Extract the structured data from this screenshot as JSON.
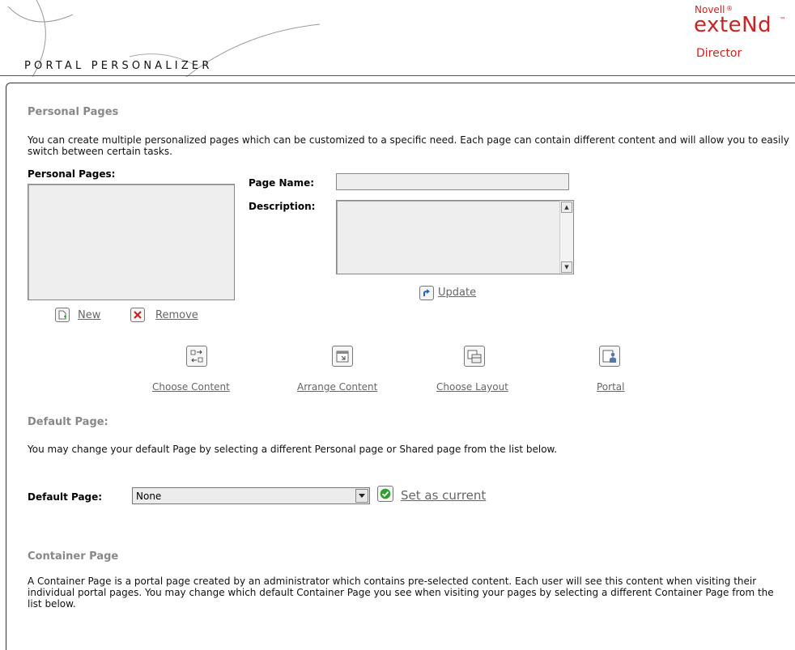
{
  "header": {
    "app_title": "PORTAL PERSONALIZER",
    "logo": {
      "novell": "Novell",
      "extend": "exteNd",
      "tm": "™",
      "director": "Director"
    }
  },
  "personal_pages": {
    "heading": "Personal Pages",
    "intro": "You can create multiple personalized pages which can be customized to a specific need. Each page can contain different content and will allow you to easily switch between certain tasks.",
    "list_label": "Personal Pages:",
    "page_name_label": "Page Name:",
    "page_name_value": "",
    "description_label": "Description:",
    "description_value": "",
    "update_label": "Update",
    "new_label": "New",
    "remove_label": "Remove"
  },
  "actions": {
    "choose_content": "Choose Content",
    "arrange_content": "Arrange Content",
    "choose_layout": "Choose Layout",
    "portal": "Portal"
  },
  "default_page": {
    "heading": "Default Page:",
    "description": "You may change your default Page by selecting a different Personal page or Shared page from the list below.",
    "field_label": "Default Page:",
    "selected_value": "None",
    "set_current_label": "Set as current"
  },
  "container_page": {
    "heading": "Container Page",
    "description": "A Container Page is a portal page created by an administrator which contains pre-selected content. Each user will see this content when visiting their individual portal pages. You may change which default Container Page you see when visiting your pages by selecting a different Container Page from the list below."
  },
  "colors": {
    "brand_red": "#cc2222",
    "heading_gray": "#888888",
    "link_gray": "#666666",
    "ok_green": "#2e9e2e",
    "remove_red": "#cc2020",
    "update_blue": "#2266cc"
  }
}
